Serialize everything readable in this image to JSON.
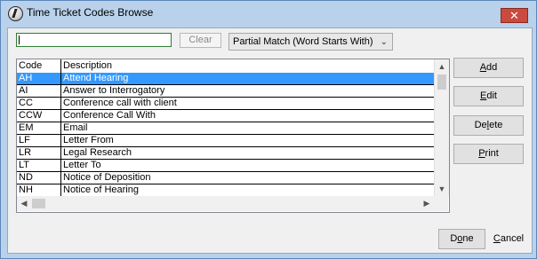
{
  "window": {
    "title": "Time Ticket Codes Browse",
    "close_glyph": "✕"
  },
  "search": {
    "value": "",
    "clear_label": "Clear",
    "match_mode": "Partial Match (Word Starts With)"
  },
  "grid": {
    "columns": [
      "Code",
      "Description"
    ],
    "rows": [
      {
        "code": "AH",
        "description": "Attend Hearing",
        "selected": true
      },
      {
        "code": "AI",
        "description": "Answer to Interrogatory"
      },
      {
        "code": "CC",
        "description": "Conference call with client"
      },
      {
        "code": "CCW",
        "description": "Conference Call With"
      },
      {
        "code": "EM",
        "description": "Email"
      },
      {
        "code": "LF",
        "description": "Letter From"
      },
      {
        "code": "LR",
        "description": "Legal Research"
      },
      {
        "code": "LT",
        "description": "Letter To"
      },
      {
        "code": "ND",
        "description": "Notice of Deposition"
      },
      {
        "code": "NH",
        "description": "Notice of Hearing"
      }
    ]
  },
  "buttons": {
    "add": {
      "mnemonic": "A",
      "rest": "dd"
    },
    "edit": {
      "mnemonic": "E",
      "rest": "dit"
    },
    "delete": {
      "pre": "De",
      "mnemonic": "l",
      "rest": "ete"
    },
    "print": {
      "mnemonic": "P",
      "rest": "rint"
    },
    "done": {
      "pre": "D",
      "mnemonic": "o",
      "rest": "ne"
    },
    "cancel": {
      "mnemonic": "C",
      "rest": "ancel"
    }
  },
  "icons": {
    "app": "app-logo-icon",
    "close": "close-icon"
  },
  "colors": {
    "selection": "#3399ff",
    "close": "#c94a3f"
  }
}
